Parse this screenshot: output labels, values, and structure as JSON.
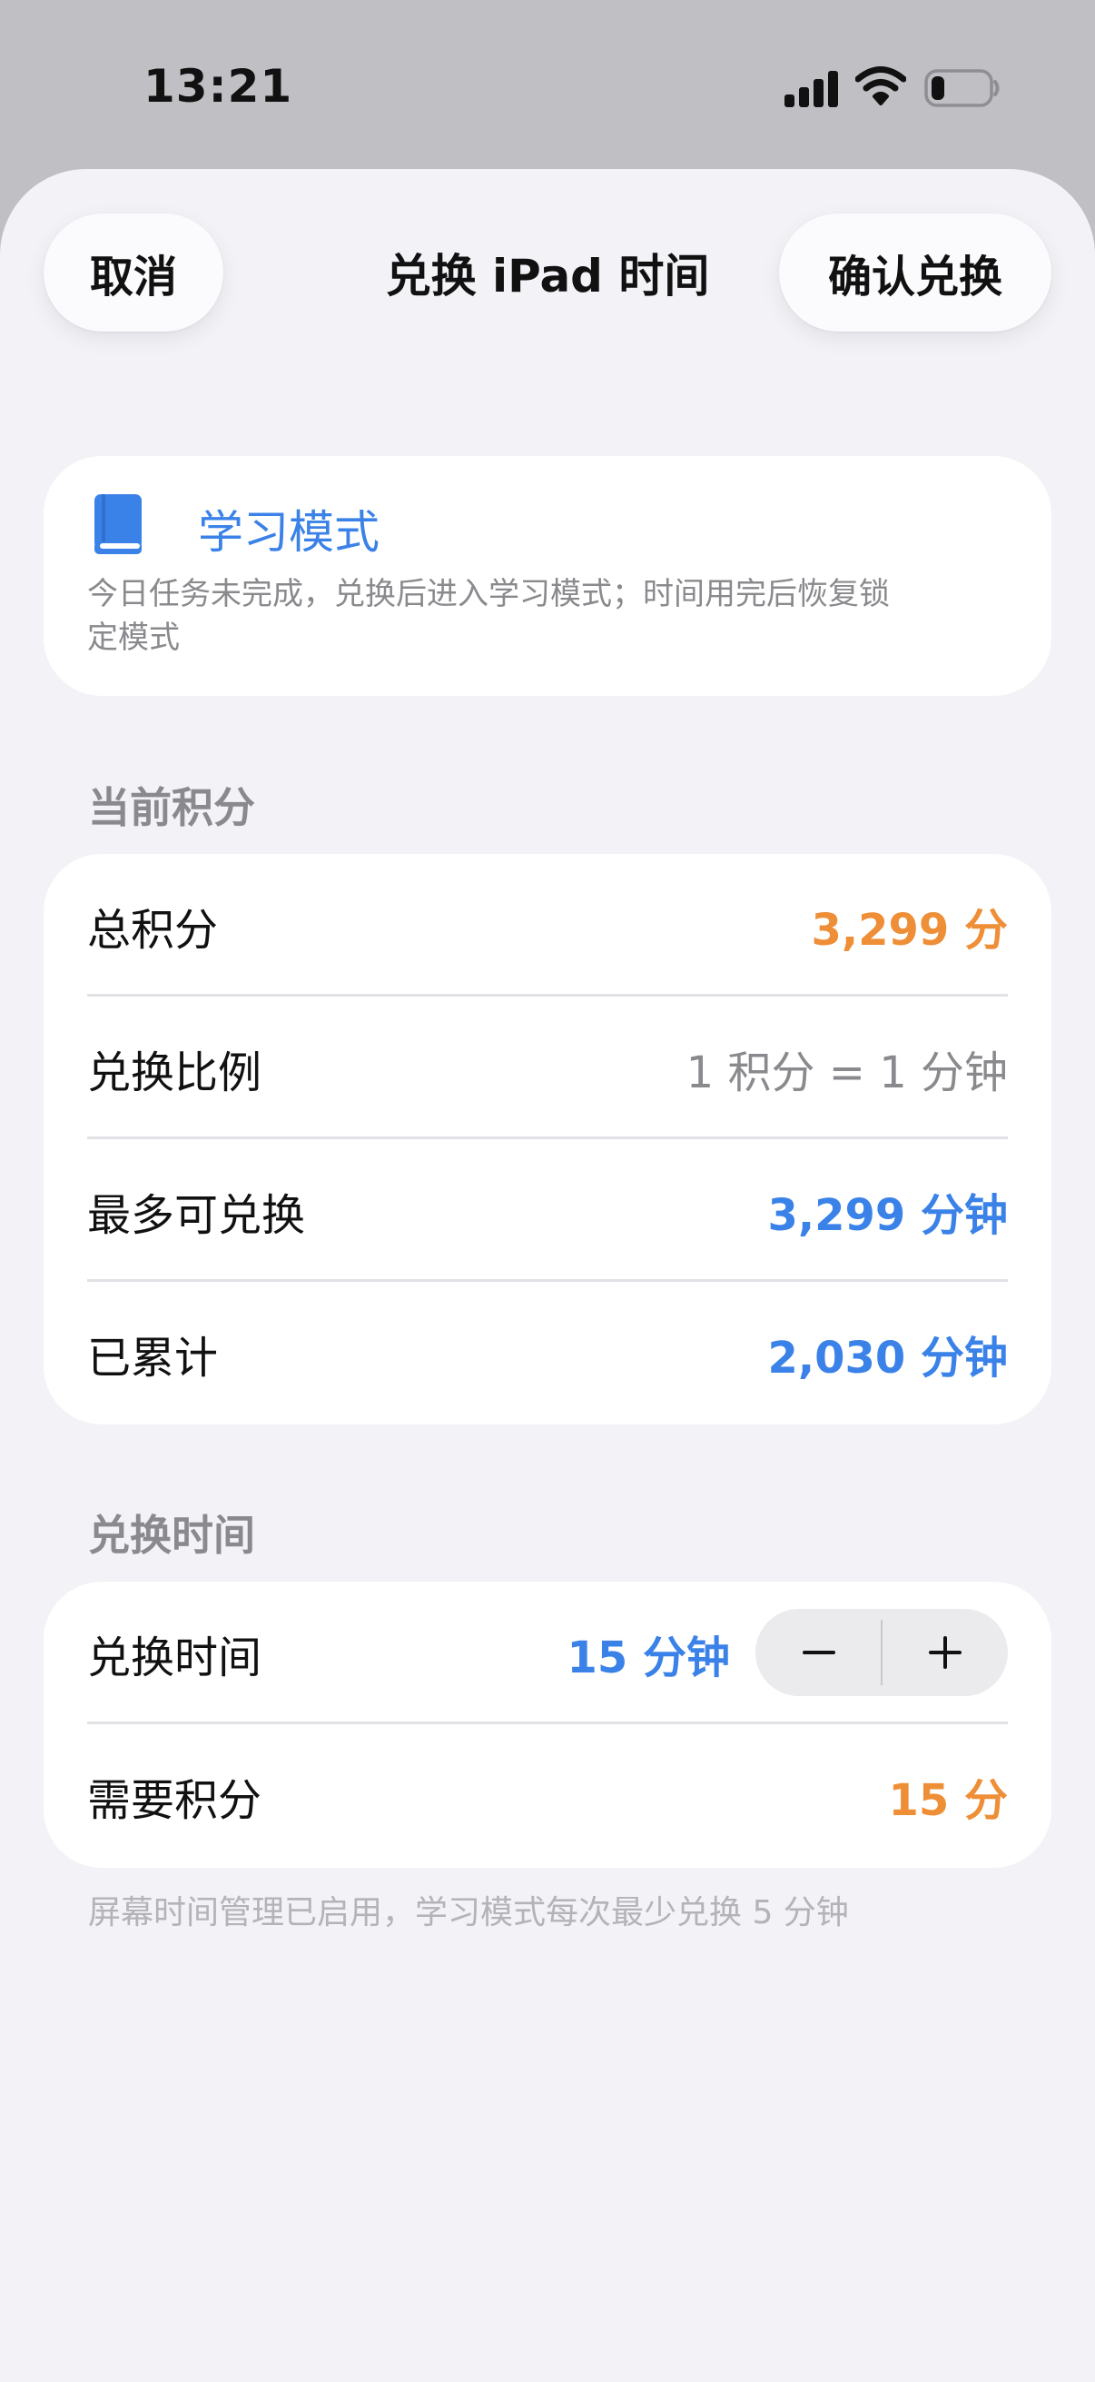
{
  "status_bar": {
    "time": "13:21",
    "icons": [
      "cellular-signal-icon",
      "wifi-icon",
      "battery-low-icon"
    ]
  },
  "nav": {
    "cancel_label": "取消",
    "title": "兑换 iPad 时间",
    "confirm_label": "确认兑换"
  },
  "mode_card": {
    "icon": "book-icon",
    "title": "学习模式",
    "description": "今日任务未完成，兑换后进入学习模式；时间用完后恢复锁定模式"
  },
  "points_section": {
    "header": "当前积分",
    "rows": [
      {
        "label": "总积分",
        "value": "3,299 分"
      },
      {
        "label": "兑换比例",
        "value": "1 积分 = 1 分钟"
      },
      {
        "label": "最多可兑换",
        "value": "3,299 分钟"
      },
      {
        "label": "已累计",
        "value": "2,030 分钟"
      }
    ]
  },
  "exchange_section": {
    "header": "兑换时间",
    "time_row": {
      "label": "兑换时间",
      "value": "15 分钟"
    },
    "stepper": {
      "minus": "−",
      "plus": "+"
    },
    "points_row": {
      "label": "需要积分",
      "value": "15 分"
    }
  },
  "footnote": "屏幕时间管理已启用，学习模式每次最少兑换 5 分钟",
  "colors": {
    "accent_blue": "#3b82e8",
    "accent_orange": "#ee8f38",
    "background": "#f2f2f7",
    "card": "#ffffff"
  }
}
